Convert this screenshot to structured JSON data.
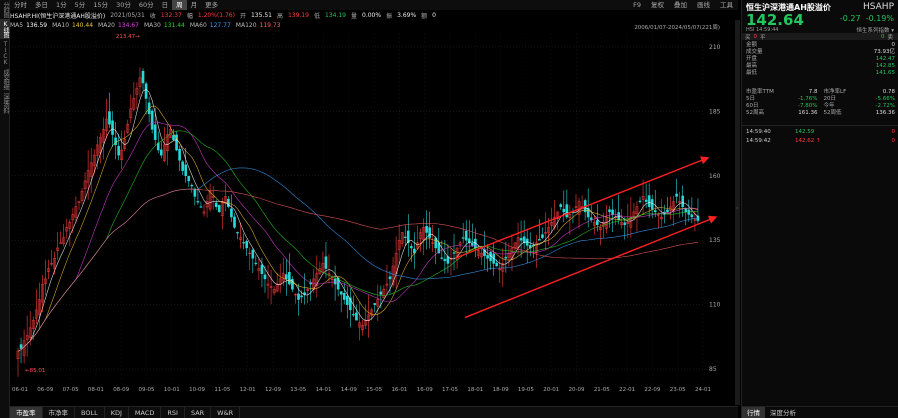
{
  "sidebar": {
    "tabs": [
      "分时图",
      "K线图",
      "TICK",
      "成交明细",
      "深度资料"
    ]
  },
  "toolbar": {
    "periods": [
      "分时",
      "多日",
      "1分",
      "5分",
      "15分",
      "30分",
      "60分",
      "日",
      "周",
      "月",
      "更多"
    ],
    "active_period": "周",
    "right_items": [
      "F9",
      "复权",
      "叠加",
      "画线",
      "工具"
    ]
  },
  "quote_line": {
    "name": "HSAHP.HI(恒生沪深港通AH股溢价)",
    "date": "2021/05/31",
    "close_label": "收",
    "close": "132.37",
    "change_label": "幅",
    "change": "1.20%(1.76)",
    "open_label": "开",
    "open": "135.51",
    "high_label": "高",
    "high": "139.19",
    "low_label": "低",
    "low": "134.19",
    "vol_label": "量",
    "vol": "0.00%",
    "amp_label": "振",
    "amp": "3.69%",
    "amt_label": "额",
    "amt": "0"
  },
  "ma_line": [
    {
      "label": "MA5",
      "value": "136.59",
      "color": "#ffffff"
    },
    {
      "label": "MA10",
      "value": "140.44",
      "color": "#f2c230"
    },
    {
      "label": "MA20",
      "value": "134.67",
      "color": "#e040e0"
    },
    {
      "label": "MA30",
      "value": "131.44",
      "color": "#28d428"
    },
    {
      "label": "MA60",
      "value": "127.77",
      "color": "#3aa0ff"
    },
    {
      "label": "MA120",
      "value": "119.73",
      "color": "#ff6060"
    }
  ],
  "range_label": "2006/01/07-2024/05/07(221周)",
  "chart_data": {
    "type": "candlestick",
    "y_ticks": [
      "210",
      "185",
      "160",
      "135",
      "110",
      "85"
    ],
    "y_range": [
      80,
      215
    ],
    "x_ticks": [
      "06-01",
      "06-09",
      "07-05",
      "08-01",
      "08-09",
      "09-05",
      "10-01",
      "10-09",
      "11-05",
      "12-01",
      "12-09",
      "13-05",
      "14-01",
      "14-09",
      "15-05",
      "16-01",
      "16-09",
      "17-05",
      "18-01",
      "18-09",
      "19-05",
      "20-01",
      "20-09",
      "21-05",
      "22-01",
      "22-09",
      "23-05",
      "24-01"
    ],
    "annotations": [
      {
        "text": "213.47",
        "x_date": "2008-01",
        "y": 213.47
      },
      {
        "text": "85.01",
        "x_date": "2006-03",
        "y": 85.01
      }
    ],
    "weekly_close": [
      92,
      93,
      96,
      98,
      101,
      104,
      108,
      112,
      118,
      120,
      124,
      126,
      128,
      132,
      134,
      136,
      140,
      142,
      145,
      148,
      150,
      154,
      158,
      162,
      165,
      168,
      172,
      175,
      178,
      182,
      180,
      176,
      172,
      168,
      170,
      174,
      180,
      186,
      190,
      194,
      198,
      196,
      190,
      184,
      178,
      174,
      170,
      168,
      172,
      176,
      178,
      174,
      170,
      166,
      162,
      160,
      158,
      156,
      152,
      150,
      148,
      146,
      150,
      154,
      152,
      148,
      146,
      150,
      152,
      148,
      144,
      140,
      138,
      136,
      134,
      132,
      130,
      128,
      126,
      124,
      122,
      120,
      118,
      117,
      116,
      118,
      120,
      122,
      120,
      118,
      116,
      114,
      112,
      113,
      114,
      116,
      118,
      120,
      122,
      124,
      126,
      124,
      122,
      120,
      118,
      116,
      114,
      112,
      110,
      108,
      106,
      104,
      103,
      102,
      104,
      106,
      108,
      110,
      112,
      114,
      116,
      118,
      120,
      125,
      130,
      135,
      138,
      136,
      134,
      132,
      130,
      134,
      138,
      140,
      138,
      136,
      134,
      132,
      130,
      128,
      127,
      126,
      128,
      130,
      132,
      134,
      136,
      135,
      134,
      133,
      132,
      131,
      130,
      129,
      128,
      127,
      126,
      125,
      124,
      126,
      128,
      130,
      132,
      134,
      136,
      135,
      134,
      133,
      132,
      133,
      134,
      135,
      136,
      138,
      140,
      142,
      144,
      146,
      148,
      146,
      144,
      145,
      146,
      148,
      150,
      148,
      146,
      144,
      143,
      142,
      141,
      140,
      142,
      144,
      146,
      145,
      144,
      143,
      142,
      141,
      142,
      144,
      146,
      148,
      150,
      152,
      150,
      148,
      147,
      146,
      145,
      144,
      145,
      146,
      148,
      150,
      152,
      150,
      148,
      146,
      145,
      144,
      143,
      142.64
    ]
  },
  "bottom_tabs": [
    "市盈率",
    "市净率",
    "BOLL",
    "KDJ",
    "MACD",
    "RSI",
    "SAR",
    "W&R"
  ],
  "panel": {
    "title": "恒生沪深港通AH股溢价",
    "code": "HSAHP",
    "price": "142.64",
    "change": "-0.27",
    "change_pct": "-0.19%",
    "sub": "HSI 14:59:44",
    "series_link": "恒生系列指数",
    "order_bar": {
      "buy_label": "买",
      "buy_qty": "0",
      "flat": "平",
      "sell_qty": "0",
      "sell_label": "卖"
    },
    "rows": [
      {
        "label": "金额",
        "value": "0"
      },
      {
        "label": "成交量",
        "value": "73.93亿"
      },
      {
        "label": "开盘",
        "value": "142.47"
      },
      {
        "label": "最高",
        "value": "142.85"
      },
      {
        "label": "最低",
        "value": "141.65"
      }
    ],
    "grid": [
      [
        {
          "l": "市盈率TTM",
          "v": "7.8",
          "c": "#ddd"
        },
        {
          "l": "市净率LF",
          "v": "0.78",
          "c": "#ddd"
        }
      ],
      [
        {
          "l": "5日",
          "v": "-1.76%",
          "c": "#22c55e"
        },
        {
          "l": "20日",
          "v": "-5.66%",
          "c": "#22c55e"
        }
      ],
      [
        {
          "l": "60日",
          "v": "-7.80%",
          "c": "#22c55e"
        },
        {
          "l": "今年",
          "v": "-2.72%",
          "c": "#22c55e"
        }
      ],
      [
        {
          "l": "52周高",
          "v": "161.36",
          "c": "#ddd"
        },
        {
          "l": "52周低",
          "v": "136.36",
          "c": "#ddd"
        }
      ]
    ],
    "trades": [
      {
        "time": "14:59:40",
        "price": "142.59",
        "vol": "0",
        "arrow": ""
      },
      {
        "time": "14:59:42",
        "price": "142.62",
        "vol": "0",
        "arrow": "↑"
      }
    ],
    "bottom_tabs": [
      "行情",
      "深度分析"
    ]
  }
}
